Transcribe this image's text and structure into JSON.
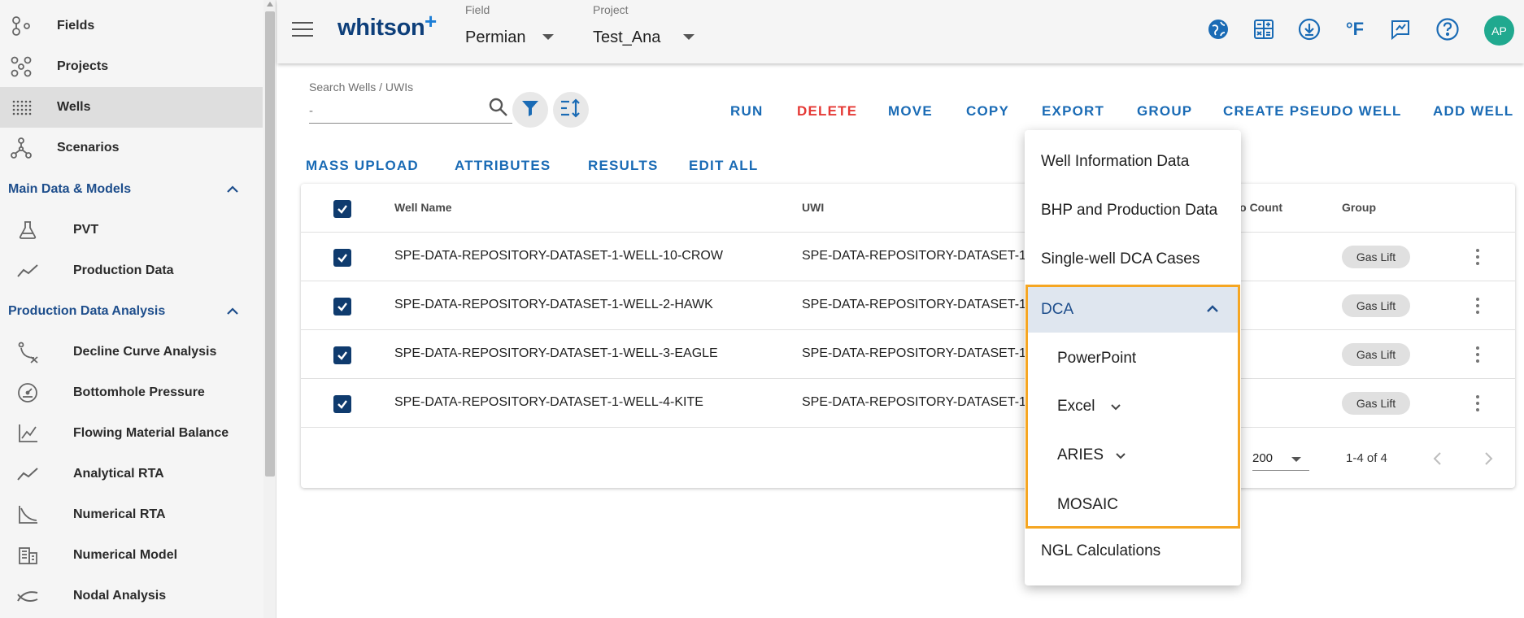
{
  "sidebar": {
    "nav": [
      {
        "label": "Fields",
        "icon": "fields-icon"
      },
      {
        "label": "Projects",
        "icon": "projects-icon"
      },
      {
        "label": "Wells",
        "icon": "wells-icon"
      },
      {
        "label": "Scenarios",
        "icon": "scenarios-icon"
      }
    ],
    "sections": [
      {
        "title": "Main Data & Models",
        "items": [
          {
            "label": "PVT",
            "icon": "flask-icon"
          },
          {
            "label": "Production Data",
            "icon": "trend-line-icon"
          }
        ]
      },
      {
        "title": "Production Data Analysis",
        "items": [
          {
            "label": "Decline Curve Analysis",
            "icon": "decline-curve-icon"
          },
          {
            "label": "Bottomhole Pressure",
            "icon": "gauge-icon"
          },
          {
            "label": "Flowing Material Balance",
            "icon": "line-chart-icon"
          },
          {
            "label": "Analytical RTA",
            "icon": "trend-line-icon"
          },
          {
            "label": "Numerical RTA",
            "icon": "curve-chart-icon"
          },
          {
            "label": "Numerical Model",
            "icon": "grid-building-icon"
          },
          {
            "label": "Nodal Analysis",
            "icon": "nodal-icon"
          }
        ]
      }
    ]
  },
  "header": {
    "logo": "whitson",
    "logo_plus": "+",
    "field_caption": "Field",
    "field_value": "Permian",
    "project_caption": "Project",
    "project_value": "Test_Ana",
    "units_label": "°F",
    "avatar_initials": "AP"
  },
  "search": {
    "caption": "Search Wells / UWIs",
    "value": "-"
  },
  "toolbar": {
    "actions": [
      "RUN",
      "DELETE",
      "MOVE",
      "COPY",
      "EXPORT",
      "GROUP",
      "CREATE PSEUDO WELL",
      "ADD WELL"
    ],
    "secondary": [
      "MASS UPLOAD",
      "ATTRIBUTES",
      "RESULTS",
      "EDIT ALL"
    ]
  },
  "table": {
    "columns": {
      "well_name": "Well Name",
      "uwi": "UWI",
      "scenario_count": "ario Count",
      "group": "Group"
    },
    "rows": [
      {
        "well_name": "SPE-DATA-REPOSITORY-DATASET-1-WELL-10-CROW",
        "uwi": "SPE-DATA-REPOSITORY-DATASET-1",
        "group": "Gas Lift",
        "checked": true
      },
      {
        "well_name": "SPE-DATA-REPOSITORY-DATASET-1-WELL-2-HAWK",
        "uwi": "SPE-DATA-REPOSITORY-DATASET-1",
        "group": "Gas Lift",
        "checked": true
      },
      {
        "well_name": "SPE-DATA-REPOSITORY-DATASET-1-WELL-3-EAGLE",
        "uwi": "SPE-DATA-REPOSITORY-DATASET-1",
        "group": "Gas Lift",
        "checked": true
      },
      {
        "well_name": "SPE-DATA-REPOSITORY-DATASET-1-WELL-4-KITE",
        "uwi": "SPE-DATA-REPOSITORY-DATASET-1",
        "group": "Gas Lift",
        "checked": true
      }
    ],
    "rows_per_page": "200",
    "range_label": "1-4 of 4"
  },
  "export_menu": {
    "items_top": [
      "Well Information Data",
      "BHP and Production Data",
      "Single-well DCA Cases"
    ],
    "group_title": "DCA",
    "group_items": [
      "PowerPoint",
      "Excel",
      "ARIES",
      "MOSAIC"
    ],
    "items_bottom": [
      "NGL Calculations"
    ]
  },
  "colors": {
    "primary": "#1a6bb5",
    "navy": "#0f3b6e",
    "danger": "#e53935",
    "highlight": "#f5a623",
    "avatar": "#20a98f"
  }
}
